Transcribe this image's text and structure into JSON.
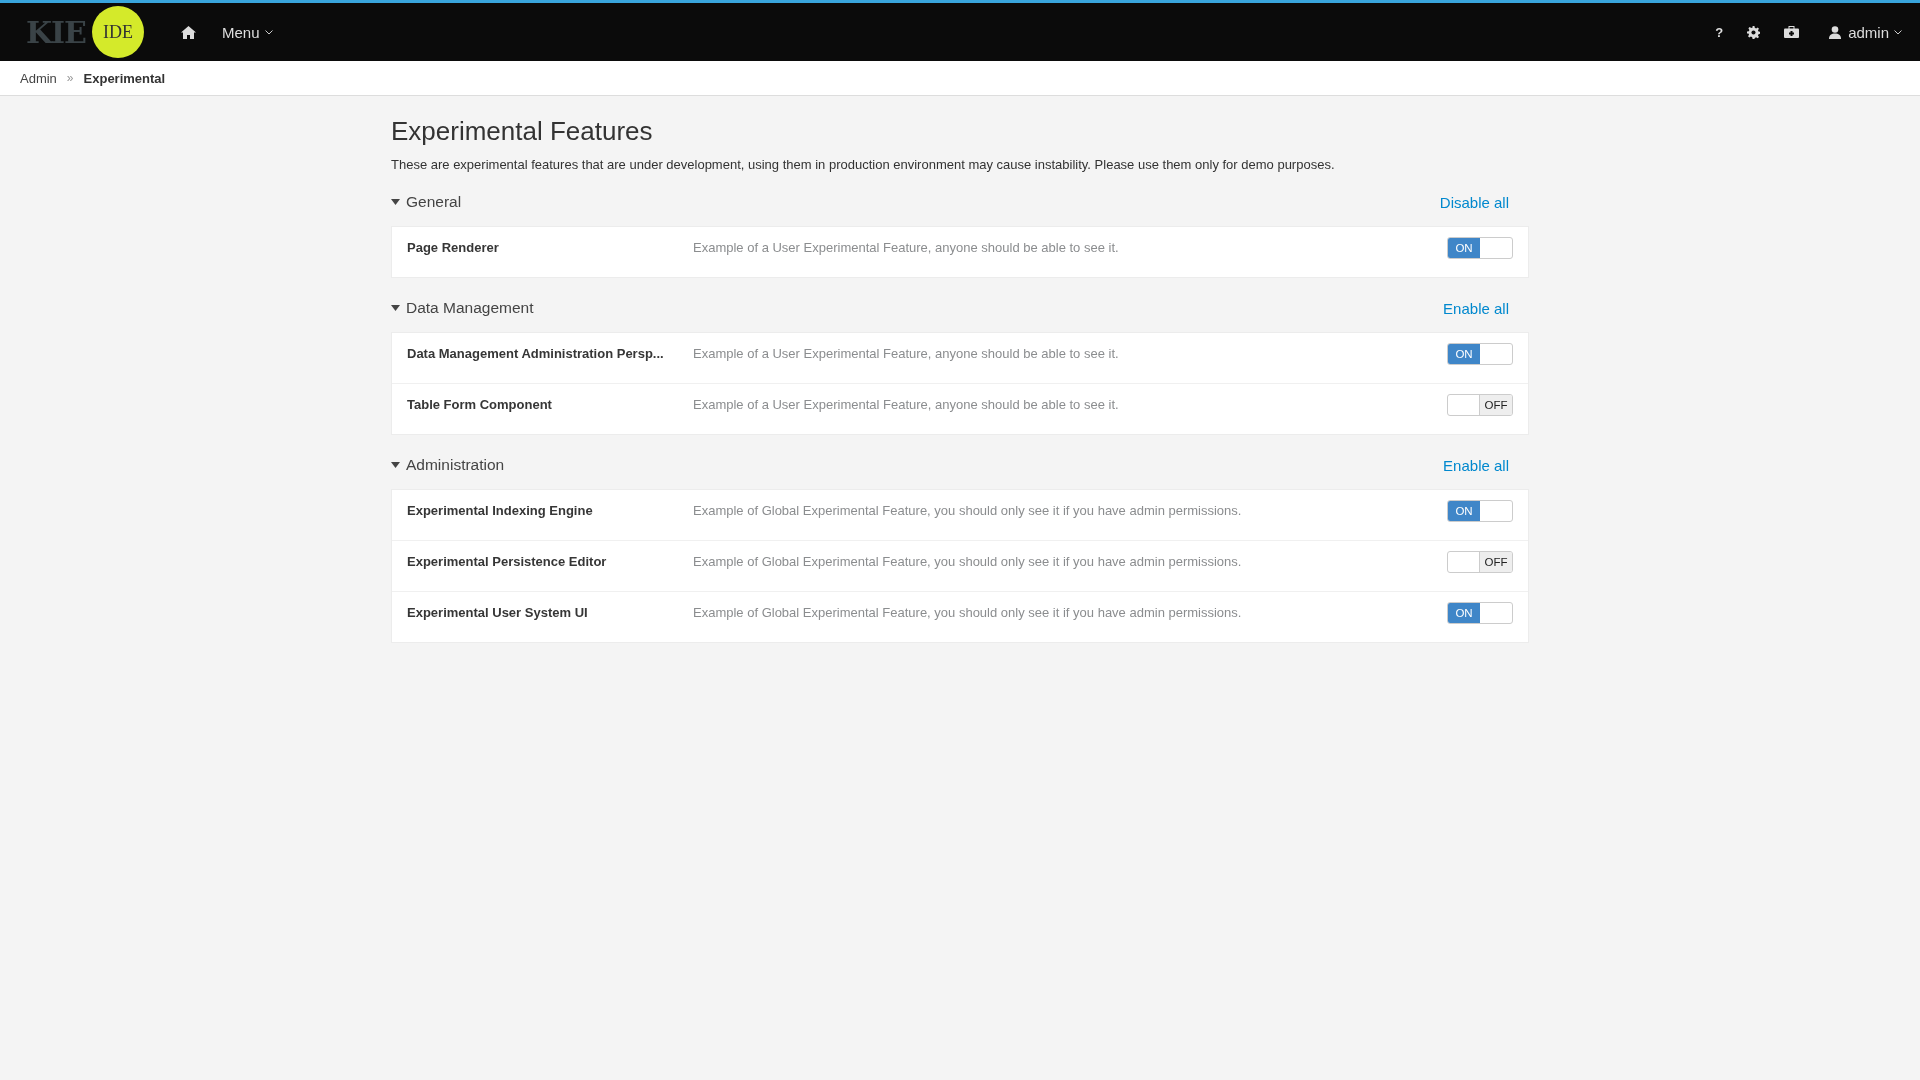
{
  "navbar": {
    "logo_text": "KIE",
    "logo_badge": "IDE",
    "menu": "Menu",
    "user": "admin",
    "help": "?"
  },
  "breadcrumb_separator": "»",
  "breadcrumb": [
    {
      "label": "Admin",
      "selected": false
    },
    {
      "label": "Experimental",
      "selected": true
    }
  ],
  "page": {
    "title": "Experimental Features",
    "description": "These are experimental features that are under development, using them in production environment may cause instability. Please use them only for demo purposes."
  },
  "sections": [
    {
      "title": "General",
      "expanded": true,
      "action": "Disable all",
      "features": [
        {
          "name": "Page Renderer",
          "description": "Example of a User Experimental Feature, anyone should be able to see it.",
          "on": true,
          "switch_label": "ON"
        }
      ]
    },
    {
      "title": "Data Management",
      "expanded": true,
      "action": "Enable all",
      "features": [
        {
          "name": "Data Management Administration Persp...",
          "description": "Example of a User Experimental Feature, anyone should be able to see it.",
          "on": true,
          "switch_label": "ON"
        },
        {
          "name": "Table Form Component",
          "description": "Example of a User Experimental Feature, anyone should be able to see it.",
          "on": false,
          "switch_label": "OFF"
        }
      ]
    },
    {
      "title": "Administration",
      "expanded": true,
      "action": "Enable all",
      "features": [
        {
          "name": "Experimental Indexing Engine",
          "description": "Example of Global Experimental Feature, you should only see it if you have admin permissions.",
          "on": true,
          "switch_label": "ON"
        },
        {
          "name": "Experimental Persistence Editor",
          "description": "Example of Global Experimental Feature, you should only see it if you have admin permissions.",
          "on": false,
          "switch_label": "OFF"
        },
        {
          "name": "Experimental User System UI",
          "description": "Example of Global Experimental Feature, you should only see it if you have admin permissions.",
          "on": true,
          "switch_label": "ON"
        }
      ]
    }
  ]
}
